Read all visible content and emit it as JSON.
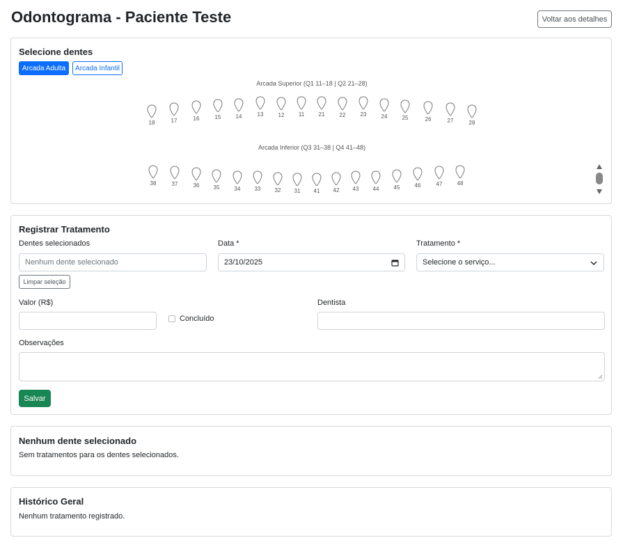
{
  "page": {
    "title": "Odontograma - Paciente Teste",
    "back_label": "Voltar aos detalhes"
  },
  "selector": {
    "title": "Selecione dentes",
    "arch_tabs": [
      {
        "label": "Arcada Adulta",
        "active": true
      },
      {
        "label": "Arcada Infantil",
        "active": false
      }
    ],
    "upper_label": "Arcada Superior (Q1 11–18 | Q2 21–28)",
    "lower_label": "Arcada Inferior (Q3 31–38 | Q4 41–48)",
    "upper_teeth": [
      "18",
      "17",
      "16",
      "15",
      "14",
      "13",
      "12",
      "11",
      "21",
      "22",
      "23",
      "24",
      "25",
      "26",
      "27",
      "28"
    ],
    "lower_teeth": [
      "38",
      "37",
      "36",
      "35",
      "34",
      "33",
      "32",
      "31",
      "41",
      "42",
      "43",
      "44",
      "45",
      "46",
      "47",
      "48"
    ]
  },
  "treatment_form": {
    "title": "Registrar Tratamento",
    "selected_teeth_label": "Dentes selecionados",
    "selected_teeth_placeholder": "Nenhum dente selecionado",
    "clear_selection_label": "Limpar seleção",
    "date_label": "Data *",
    "date_value": "23/10/2025",
    "treatment_label": "Tratamento *",
    "treatment_value": "Selecione o serviço...",
    "value_label": "Valor (R$)",
    "value_value": "",
    "done_label": "Concluído",
    "done_checked": false,
    "dentist_label": "Dentista",
    "dentist_value": "",
    "notes_label": "Observações",
    "notes_value": "",
    "save_label": "Salvar"
  },
  "selected_panel": {
    "title": "Nenhum dente selecionado",
    "text": "Sem tratamentos para os dentes selecionados."
  },
  "history_panel": {
    "title": "Histórico Geral",
    "text": "Nenhum tratamento registrado."
  },
  "colors": {
    "primary": "#0d6efd",
    "success": "#198754",
    "tooth_stroke": "#777777"
  }
}
